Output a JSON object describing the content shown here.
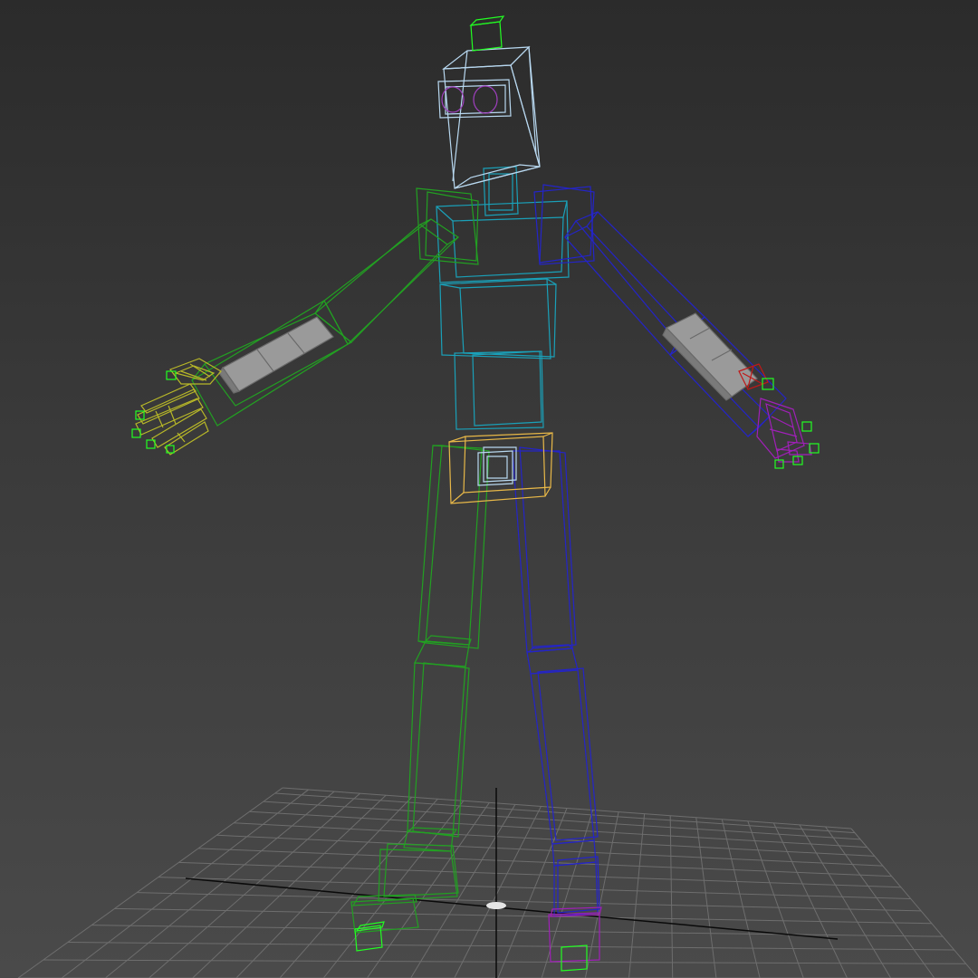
{
  "viewport": {
    "view": "perspective",
    "shading": "wireframe",
    "background_top": "#2b2b2b",
    "background_bottom": "#4a4a4a"
  },
  "colors": {
    "grid": "#6e6e6e",
    "grid_axis": "#0a0a0a",
    "head": "#b8d8f0",
    "eyes": "#a040c0",
    "spine": "#1aa0b8",
    "left_side": "#22a022",
    "right_side": "#2424c8",
    "pelvis": "#e8b848",
    "pelvis_inner": "#b8d8f0",
    "left_hand": "#b8b828",
    "right_hand": "#a020b8",
    "helper": "#22ff22",
    "wrist_helper": "#c01818",
    "forearm_mesh": "#9a9a9a",
    "pivot": "#e6e6e6"
  },
  "scene": {
    "grid": "home-grid",
    "rig": "biped",
    "pivot_marker": "scene-origin"
  }
}
